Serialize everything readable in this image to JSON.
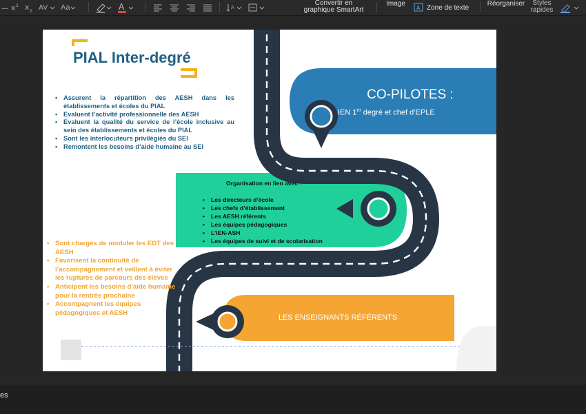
{
  "toolbar": {
    "convert_smartart": [
      "Convertir en",
      "graphique SmartArt"
    ],
    "image": "Image",
    "textbox": "Zone de texte",
    "reorganize": "Réorganiser",
    "quick_styles": [
      "Styles",
      "rapides"
    ],
    "font_case": "Aa"
  },
  "slide": {
    "title": "PIAL Inter-degré",
    "copilots_title": "CO-PILOTES :",
    "copilots_sub_prefix": "IEN 1",
    "copilots_sub_sup": "er",
    "copilots_sub_suffix": " degré et chef d’EPLE",
    "blue_bullets": [
      "Assurent la répartition des AESH dans les établissements et écoles du PIAL",
      "Evaluent l’activité professionnelle des AESH",
      "Evaluent la qualité du service de l’école inclusive au sein des établissements et écoles du PIAL",
      "Sont les interlocuteurs privilégiés du SEI",
      "Remontent les besoins d’aide humaine au SEI"
    ],
    "organisation_title": "Organisation en lien avec :",
    "green_bullets": [
      "Les directeurs d’école",
      "Les chefs d’établissement",
      "Les AESH référents",
      "Les équipes pédagogiques",
      "L’IEN-ASH",
      "Les équipes de suivi et de scolarisation"
    ],
    "orange_bullets": [
      "Sont chargés de moduler les EDT des AESH",
      "Favorisent la continuité de l’accompagnement et veillent à éviter les ruptures de parcours des élèves",
      "Anticipent les besoins d’aide humaine pour la rentrée prochaine",
      "Accompagnent les équipes pédagogiques et AESH"
    ],
    "referents_label": "LES ENSEIGNANTS RÉFÉRENTS"
  },
  "status": {
    "notes_fragment": "es"
  },
  "colors": {
    "blue": "#2a7db5",
    "green": "#1fd09a",
    "orange": "#f5a532",
    "road": "#283545",
    "title_blue": "#1f5f83"
  }
}
